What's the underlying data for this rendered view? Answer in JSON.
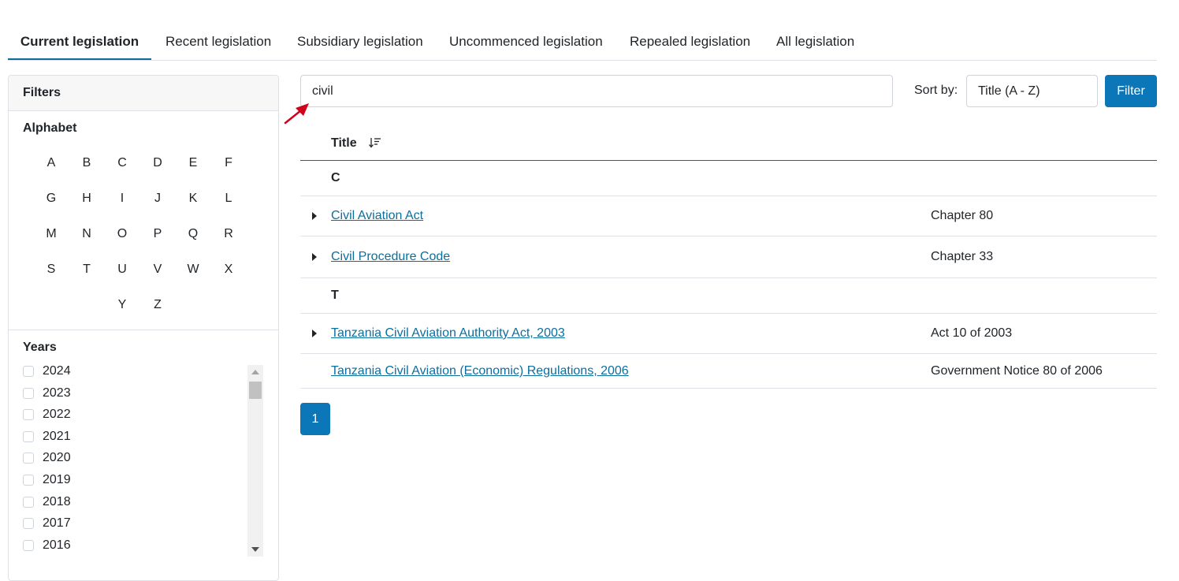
{
  "tabs": [
    {
      "label": "Current legislation",
      "active": true
    },
    {
      "label": "Recent legislation"
    },
    {
      "label": "Subsidiary legislation"
    },
    {
      "label": "Uncommenced legislation"
    },
    {
      "label": "Repealed legislation"
    },
    {
      "label": "All legislation"
    }
  ],
  "sidebar": {
    "title": "Filters",
    "alphabet_title": "Alphabet",
    "letters": [
      "A",
      "B",
      "C",
      "D",
      "E",
      "F",
      "G",
      "H",
      "I",
      "J",
      "K",
      "L",
      "M",
      "N",
      "O",
      "P",
      "Q",
      "R",
      "S",
      "T",
      "U",
      "V",
      "W",
      "X",
      "Y",
      "Z"
    ],
    "years_title": "Years",
    "years": [
      "2024",
      "2023",
      "2022",
      "2021",
      "2020",
      "2019",
      "2018",
      "2017",
      "2016"
    ]
  },
  "search": {
    "value": "civil"
  },
  "sort": {
    "label": "Sort by:",
    "value": "Title (A - Z)"
  },
  "filter_button": "Filter",
  "table": {
    "header": "Title",
    "groups": [
      {
        "letter": "C",
        "rows": [
          {
            "title": "Civil Aviation Act",
            "ref": "Chapter 80",
            "expandable": true
          },
          {
            "title": "Civil Procedure Code",
            "ref": "Chapter 33",
            "expandable": true
          }
        ]
      },
      {
        "letter": "T",
        "rows": [
          {
            "title": "Tanzania Civil Aviation Authority Act, 2003",
            "ref": "Act 10 of 2003",
            "expandable": true
          },
          {
            "title": "Tanzania Civil Aviation (Economic) Regulations, 2006",
            "ref": "Government Notice 80 of 2006",
            "expandable": false
          }
        ]
      }
    ]
  },
  "pagination": {
    "current": "1"
  },
  "colors": {
    "accent": "#0b77b8",
    "link": "#0d6e9e",
    "annotation_arrow": "#d0021b"
  },
  "icons": [
    "sort-desc-icon",
    "caret-right-icon",
    "red-arrow-annotation-icon"
  ]
}
